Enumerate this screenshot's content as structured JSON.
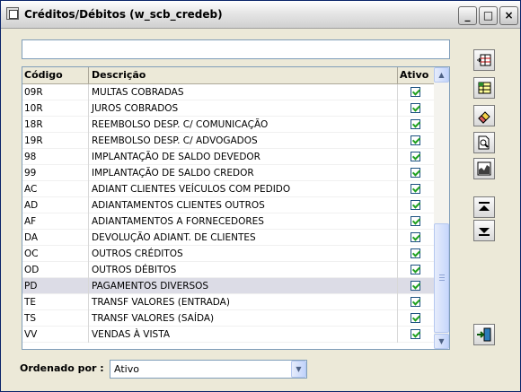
{
  "window": {
    "title": "Créditos/Débitos (w_scb_credeb)",
    "buttons": {
      "minimize": "_",
      "maximize": "□",
      "close": "×"
    }
  },
  "filter": {
    "value": ""
  },
  "grid": {
    "columns": {
      "code": "Código",
      "description": "Descrição",
      "active": "Ativo"
    },
    "rows": [
      {
        "code": "09R",
        "description": "MULTAS COBRADAS",
        "active": true
      },
      {
        "code": "10R",
        "description": "JUROS COBRADOS",
        "active": true
      },
      {
        "code": "18R",
        "description": "REEMBOLSO DESP. C/ COMUNICAÇÃO",
        "active": true
      },
      {
        "code": "19R",
        "description": "REEMBOLSO DESP. C/ ADVOGADOS",
        "active": true
      },
      {
        "code": "98",
        "description": "IMPLANTAÇÃO DE SALDO DEVEDOR",
        "active": true
      },
      {
        "code": "99",
        "description": "IMPLANTAÇÃO DE SALDO CREDOR",
        "active": true
      },
      {
        "code": "AC",
        "description": "ADIANT CLIENTES VEÍCULOS COM PEDIDO",
        "active": true
      },
      {
        "code": "AD",
        "description": "ADIANTAMENTOS CLIENTES OUTROS",
        "active": true
      },
      {
        "code": "AF",
        "description": "ADIANTAMENTOS A FORNECEDORES",
        "active": true
      },
      {
        "code": "DA",
        "description": "DEVOLUÇÃO ADIANT. DE CLIENTES",
        "active": true
      },
      {
        "code": "OC",
        "description": "OUTROS CRÉDITOS",
        "active": true
      },
      {
        "code": "OD",
        "description": "OUTROS DÉBITOS",
        "active": true
      },
      {
        "code": "PD",
        "description": "PAGAMENTOS DIVERSOS",
        "active": true
      },
      {
        "code": "TE",
        "description": "TRANSF VALORES (ENTRADA)",
        "active": true
      },
      {
        "code": "TS",
        "description": "TRANSF VALORES (SAÍDA)",
        "active": true
      },
      {
        "code": "VV",
        "description": "VENDAS À VISTA",
        "active": true
      }
    ],
    "selected_index": 12
  },
  "toolbar": {
    "icons": [
      "insert-row-icon",
      "table-grid-icon",
      "eraser-icon",
      "print-preview-icon",
      "chart-icon",
      "move-up-icon",
      "move-down-icon",
      "exit-door-icon"
    ]
  },
  "footer": {
    "ordered_label": "Ordenado por :",
    "ordered_value": "Ativo"
  },
  "colors": {
    "accent": "#7f9db9",
    "selected_row": "#dcdce6",
    "check": "#21a121"
  }
}
